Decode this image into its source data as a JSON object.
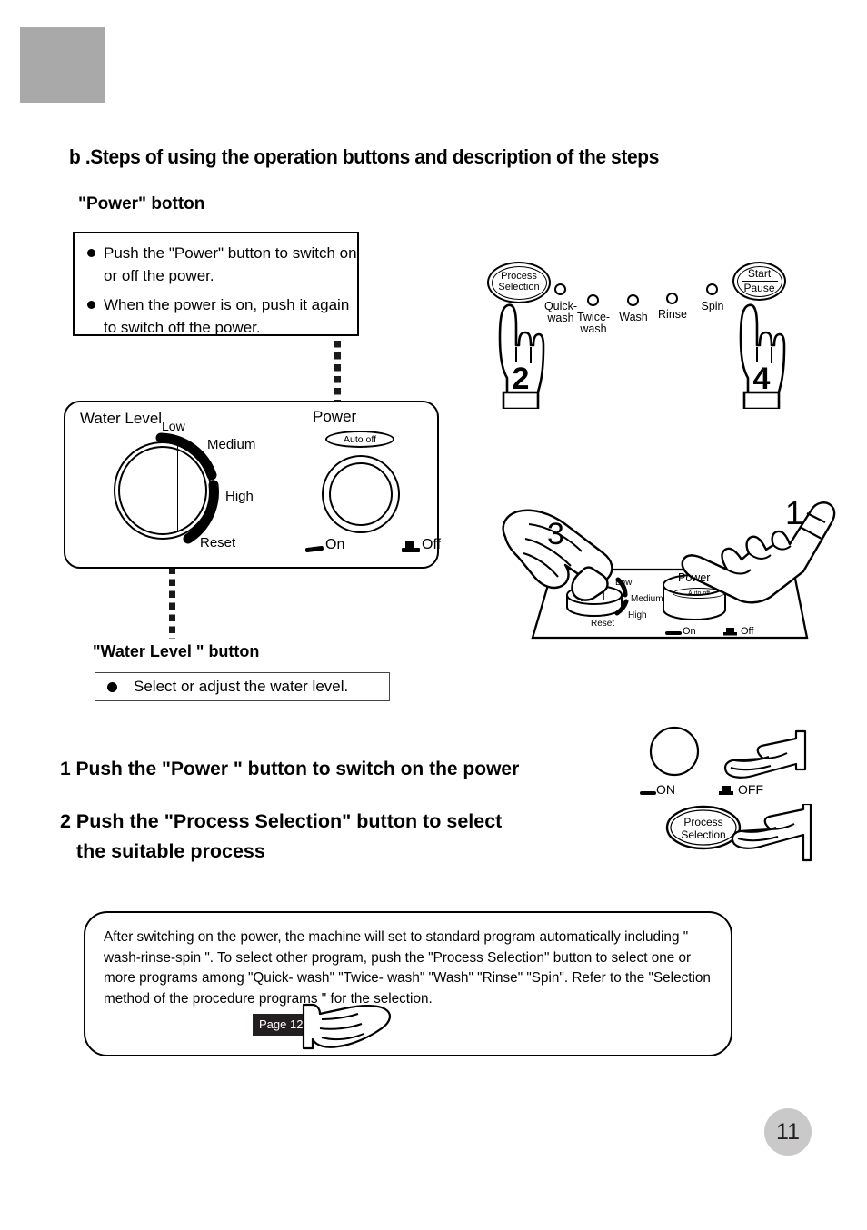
{
  "page": {
    "number": "11",
    "section_heading": "b .Steps of using the operation buttons and description of the steps"
  },
  "power_section": {
    "heading": "\"Power\" botton",
    "bullets": [
      "Push the \"Power\" button to switch on or off the power.",
      "When the power is on, push it again to switch off the power."
    ]
  },
  "water_level_section": {
    "heading": "\"Water Level \" button",
    "bullet": "Select or adjust the water level."
  },
  "control_panel": {
    "water_level_label": "Water Level",
    "power_label": "Power",
    "auto_off_label": "Auto off",
    "dial_positions": [
      "Low",
      "Medium",
      "High",
      "Reset"
    ],
    "switch_on_label": "On",
    "switch_off_label": "Off"
  },
  "process_panel": {
    "process_selection_label_line1": "Process",
    "process_selection_label_line2": "Selection",
    "start_pause_label_line1": "Start",
    "start_pause_label_line2": "Pause",
    "programs": [
      {
        "label_line1": "Quick-",
        "label_line2": "wash"
      },
      {
        "label_line1": "Twice-",
        "label_line2": "wash"
      },
      {
        "label_line1": "Wash",
        "label_line2": ""
      },
      {
        "label_line1": "Rinse",
        "label_line2": ""
      },
      {
        "label_line1": "Spin",
        "label_line2": ""
      }
    ],
    "hand_numbers": {
      "process_selection": "2",
      "start_pause": "4"
    }
  },
  "scene_mid": {
    "hand_number_dial": "3",
    "hand_number_power": "1",
    "power_label": "Power",
    "auto_off_label": "Auto off",
    "dial_positions": [
      "Low",
      "Medium",
      "High",
      "Reset"
    ],
    "switch_on_label": "On",
    "switch_off_label": "Off"
  },
  "steps": [
    "1 Push the \"Power \" button to switch on the power",
    "2 Push the \"Process Selection\" button to select\n   the suitable process"
  ],
  "mini_illustrations": {
    "power_on_label": "ON",
    "power_off_label": "OFF",
    "process_selection_line1": "Process",
    "process_selection_line2": "Selection"
  },
  "bottom_note": {
    "text": "After switching on the power, the machine will set to standard program automatically including \" wash-rinse-spin \".  To select other program, push the \"Process  Selection\" button to select one or more programs  among \"Quick- wash\" \"Twice- wash\" \"Wash\" \"Rinse\" \"Spin\". Refer  to  the  \"Selection method of the procedure programs \"  for the selection.",
    "page_reference": "Page 12"
  },
  "colors": {
    "corner_block": "#a9a9a9",
    "page_badge": "#c9c9c9",
    "ink": "#000000",
    "tag_bg": "#231f20"
  }
}
